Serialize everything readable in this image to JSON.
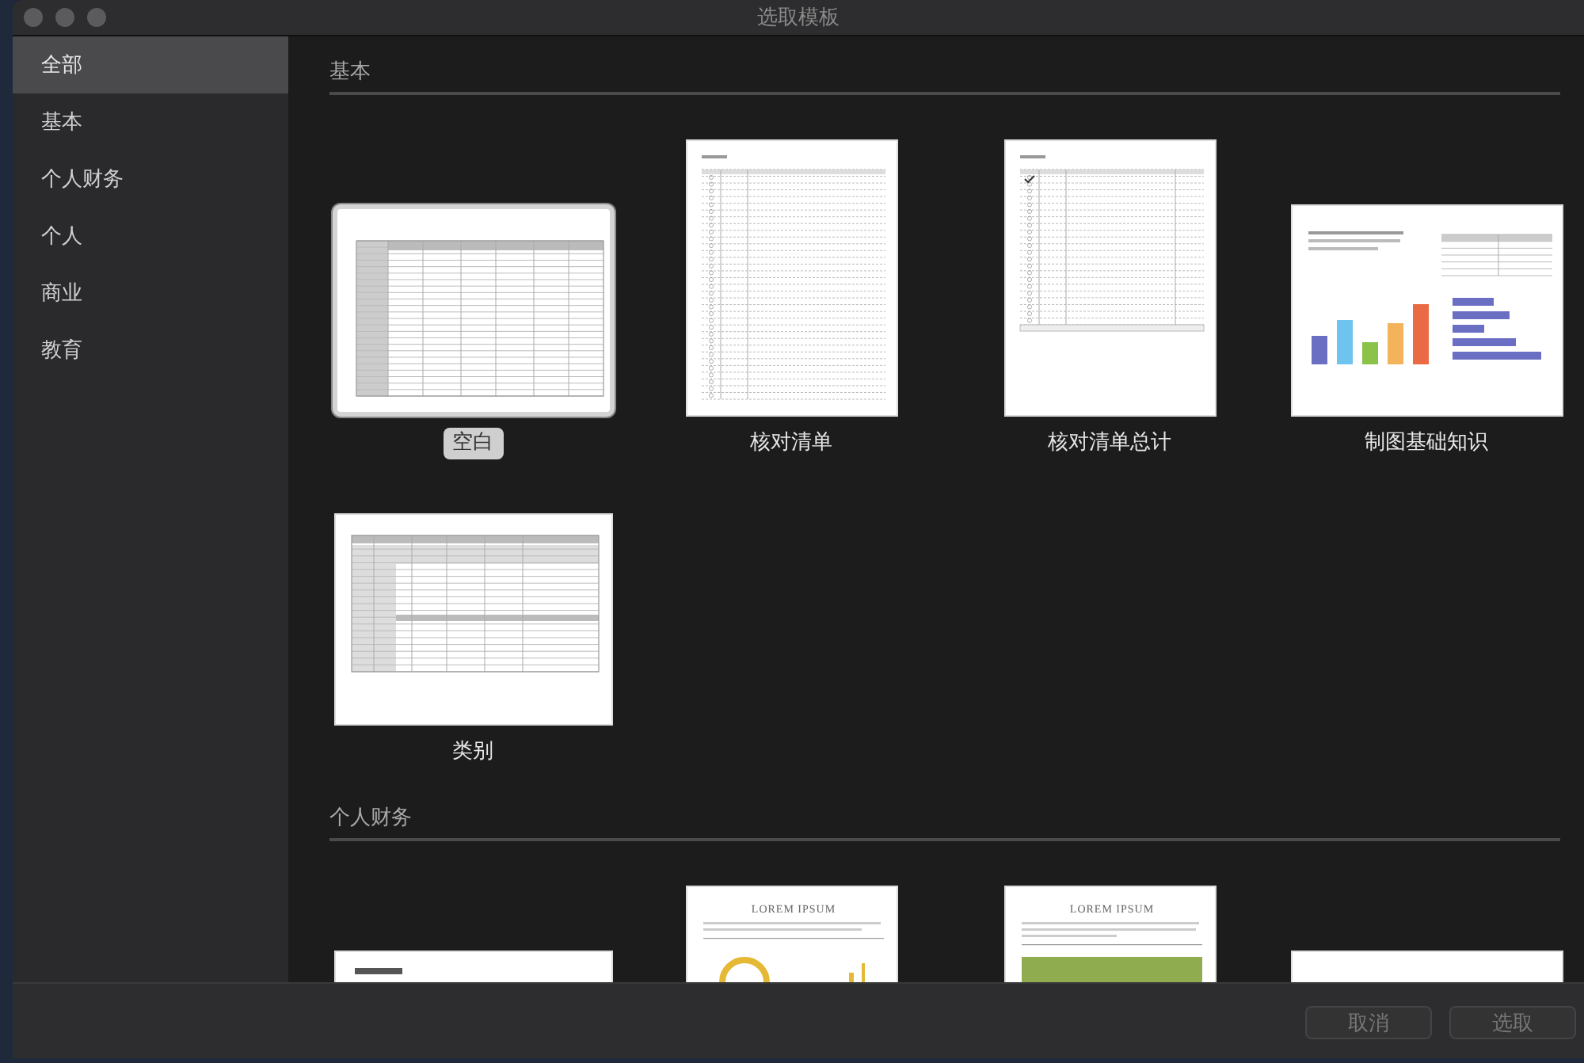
{
  "window": {
    "title": "选取模板"
  },
  "sidebar": {
    "items": [
      {
        "label": "全部",
        "selected": true
      },
      {
        "label": "基本",
        "selected": false
      },
      {
        "label": "个人财务",
        "selected": false
      },
      {
        "label": "个人",
        "selected": false
      },
      {
        "label": "商业",
        "selected": false
      },
      {
        "label": "教育",
        "selected": false
      }
    ]
  },
  "sections": [
    {
      "title": "基本",
      "templates": [
        {
          "name": "空白",
          "kind": "blank",
          "selected": true
        },
        {
          "name": "核对清单",
          "kind": "checklist",
          "selected": false
        },
        {
          "name": "核对清单总计",
          "kind": "checklist_total",
          "selected": false
        },
        {
          "name": "制图基础知识",
          "kind": "charts",
          "selected": false
        },
        {
          "name": "类别",
          "kind": "categories",
          "selected": false
        }
      ]
    },
    {
      "title": "个人财务",
      "templates": [
        {
          "kind": "document",
          "selected": false
        },
        {
          "kind": "budget",
          "heading": "LOREM IPSUM",
          "selected": false
        },
        {
          "kind": "savings",
          "heading": "LOREM IPSUM",
          "selected": false
        },
        {
          "kind": "plain",
          "selected": false
        }
      ]
    }
  ],
  "footer": {
    "buttons": [
      {
        "label": "取消",
        "disabled": true
      },
      {
        "label": "选取",
        "disabled": true
      }
    ]
  }
}
